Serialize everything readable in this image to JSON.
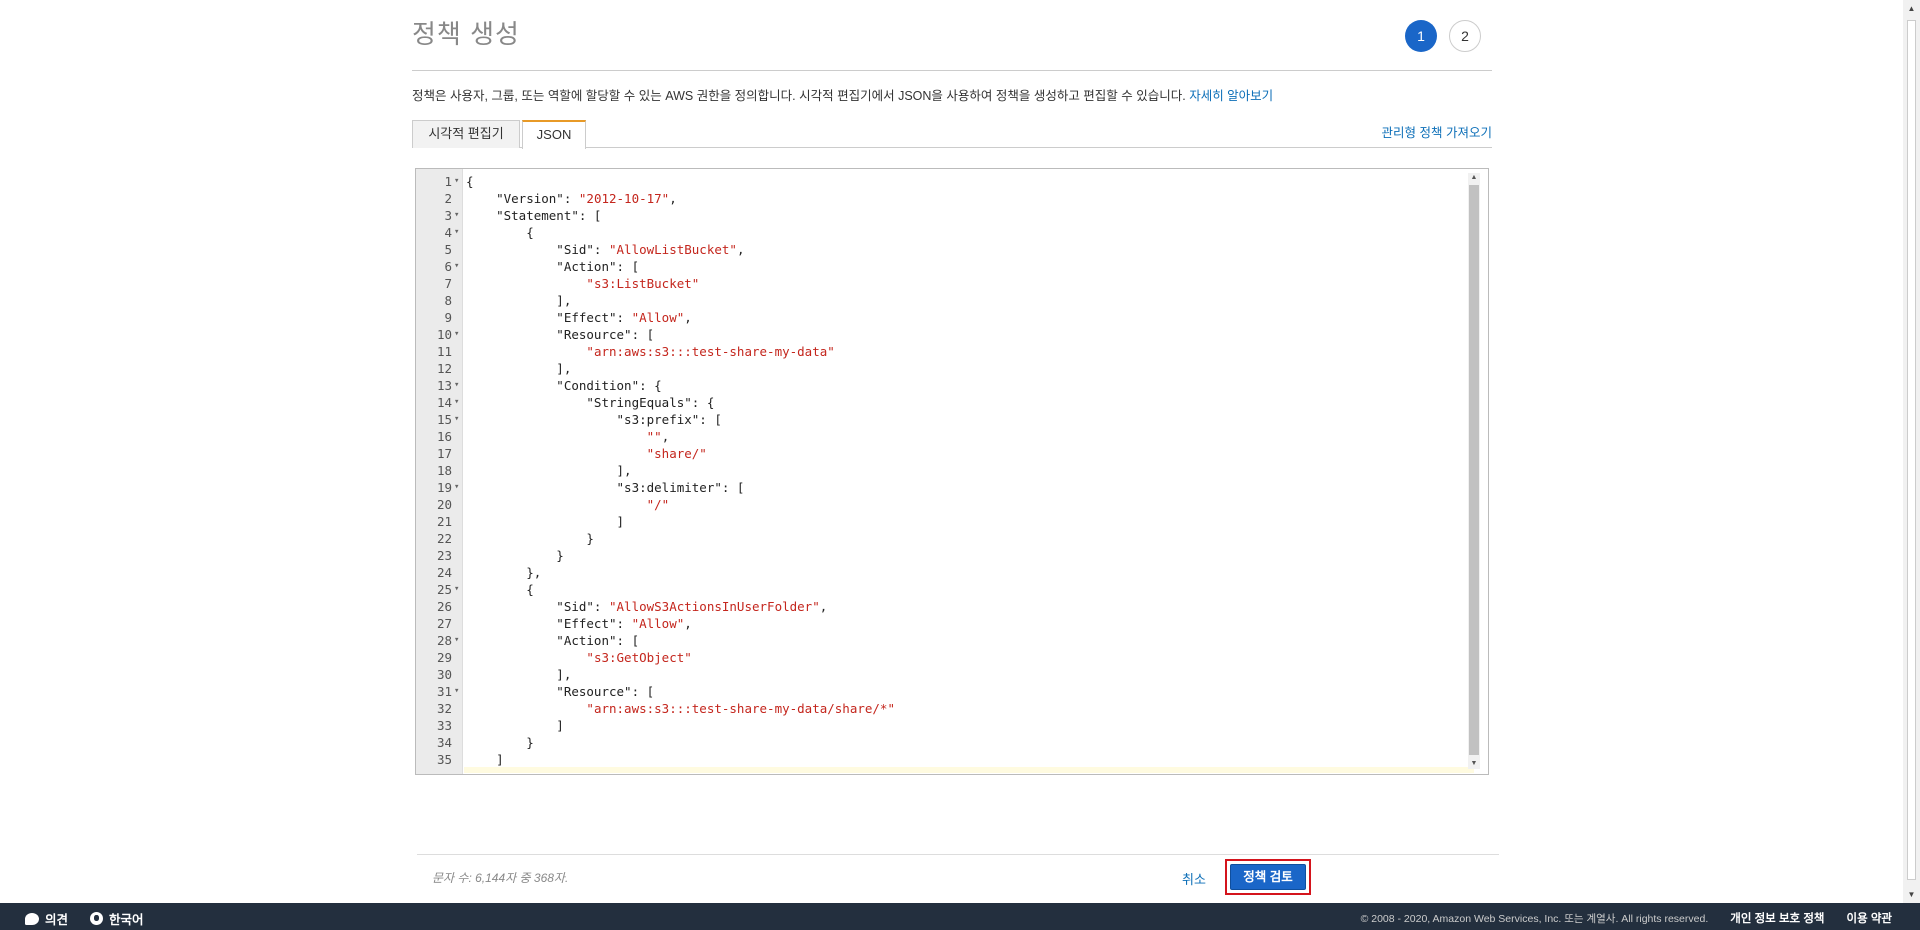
{
  "page": {
    "title": "정책 생성"
  },
  "steps": [
    "1",
    "2"
  ],
  "description": {
    "text": "정책은 사용자, 그룹, 또는 역할에 할당할 수 있는 AWS 권한을 정의합니다. 시각적 편집기에서 JSON을 사용하여 정책을 생성하고 편집할 수 있습니다. ",
    "learn_more": "자세히 알아보기"
  },
  "tabs": {
    "visual": "시각적 편집기",
    "json": "JSON"
  },
  "import_link": "관리형 정책 가져오기",
  "editor": {
    "lines": [
      {
        "n": "1",
        "fold": true,
        "code": [
          [
            "p",
            "{"
          ]
        ]
      },
      {
        "n": "2",
        "fold": false,
        "code": [
          [
            "p",
            "    \"Version\": "
          ],
          [
            "s",
            "\"2012-10-17\""
          ],
          [
            "p",
            ","
          ]
        ]
      },
      {
        "n": "3",
        "fold": true,
        "code": [
          [
            "p",
            "    \"Statement\": ["
          ]
        ]
      },
      {
        "n": "4",
        "fold": true,
        "code": [
          [
            "p",
            "        {"
          ]
        ]
      },
      {
        "n": "5",
        "fold": false,
        "code": [
          [
            "p",
            "            \"Sid\": "
          ],
          [
            "s",
            "\"AllowListBucket\""
          ],
          [
            "p",
            ","
          ]
        ]
      },
      {
        "n": "6",
        "fold": true,
        "code": [
          [
            "p",
            "            \"Action\": ["
          ]
        ]
      },
      {
        "n": "7",
        "fold": false,
        "code": [
          [
            "p",
            "                "
          ],
          [
            "s",
            "\"s3:ListBucket\""
          ]
        ]
      },
      {
        "n": "8",
        "fold": false,
        "code": [
          [
            "p",
            "            ],"
          ]
        ]
      },
      {
        "n": "9",
        "fold": false,
        "code": [
          [
            "p",
            "            \"Effect\": "
          ],
          [
            "s",
            "\"Allow\""
          ],
          [
            "p",
            ","
          ]
        ]
      },
      {
        "n": "10",
        "fold": true,
        "code": [
          [
            "p",
            "            \"Resource\": ["
          ]
        ]
      },
      {
        "n": "11",
        "fold": false,
        "code": [
          [
            "p",
            "                "
          ],
          [
            "s",
            "\"arn:aws:s3:::test-share-my-data\""
          ]
        ]
      },
      {
        "n": "12",
        "fold": false,
        "code": [
          [
            "p",
            "            ],"
          ]
        ]
      },
      {
        "n": "13",
        "fold": true,
        "code": [
          [
            "p",
            "            \"Condition\": {"
          ]
        ]
      },
      {
        "n": "14",
        "fold": true,
        "code": [
          [
            "p",
            "                \"StringEquals\": {"
          ]
        ]
      },
      {
        "n": "15",
        "fold": true,
        "code": [
          [
            "p",
            "                    \"s3:prefix\": ["
          ]
        ]
      },
      {
        "n": "16",
        "fold": false,
        "code": [
          [
            "p",
            "                        "
          ],
          [
            "s",
            "\"\""
          ],
          [
            "p",
            ","
          ]
        ]
      },
      {
        "n": "17",
        "fold": false,
        "code": [
          [
            "p",
            "                        "
          ],
          [
            "s",
            "\"share/\""
          ]
        ]
      },
      {
        "n": "18",
        "fold": false,
        "code": [
          [
            "p",
            "                    ],"
          ]
        ]
      },
      {
        "n": "19",
        "fold": true,
        "code": [
          [
            "p",
            "                    \"s3:delimiter\": ["
          ]
        ]
      },
      {
        "n": "20",
        "fold": false,
        "code": [
          [
            "p",
            "                        "
          ],
          [
            "s",
            "\"/\""
          ]
        ]
      },
      {
        "n": "21",
        "fold": false,
        "code": [
          [
            "p",
            "                    ]"
          ]
        ]
      },
      {
        "n": "22",
        "fold": false,
        "code": [
          [
            "p",
            "                }"
          ]
        ]
      },
      {
        "n": "23",
        "fold": false,
        "code": [
          [
            "p",
            "            }"
          ]
        ]
      },
      {
        "n": "24",
        "fold": false,
        "code": [
          [
            "p",
            "        },"
          ]
        ]
      },
      {
        "n": "25",
        "fold": true,
        "code": [
          [
            "p",
            "        {"
          ]
        ]
      },
      {
        "n": "26",
        "fold": false,
        "code": [
          [
            "p",
            "            \"Sid\": "
          ],
          [
            "s",
            "\"AllowS3ActionsInUserFolder\""
          ],
          [
            "p",
            ","
          ]
        ]
      },
      {
        "n": "27",
        "fold": false,
        "code": [
          [
            "p",
            "            \"Effect\": "
          ],
          [
            "s",
            "\"Allow\""
          ],
          [
            "p",
            ","
          ]
        ]
      },
      {
        "n": "28",
        "fold": true,
        "code": [
          [
            "p",
            "            \"Action\": ["
          ]
        ]
      },
      {
        "n": "29",
        "fold": false,
        "code": [
          [
            "p",
            "                "
          ],
          [
            "s",
            "\"s3:GetObject\""
          ]
        ]
      },
      {
        "n": "30",
        "fold": false,
        "code": [
          [
            "p",
            "            ],"
          ]
        ]
      },
      {
        "n": "31",
        "fold": true,
        "code": [
          [
            "p",
            "            \"Resource\": ["
          ]
        ]
      },
      {
        "n": "32",
        "fold": false,
        "code": [
          [
            "p",
            "                "
          ],
          [
            "s",
            "\"arn:aws:s3:::test-share-my-data/share/*\""
          ]
        ]
      },
      {
        "n": "33",
        "fold": false,
        "code": [
          [
            "p",
            "            ]"
          ]
        ]
      },
      {
        "n": "34",
        "fold": false,
        "code": [
          [
            "p",
            "        }"
          ]
        ]
      },
      {
        "n": "35",
        "fold": false,
        "code": [
          [
            "p",
            "    ]"
          ]
        ]
      }
    ]
  },
  "footer": {
    "char_count": "문자 수: 6,144자 중 368자.",
    "cancel": "취소",
    "review": "정책 검토"
  },
  "bottombar": {
    "feedback": "의견",
    "language": "한국어",
    "copyright": "© 2008 - 2020, Amazon Web Services, Inc. 또는 계열사. All rights reserved.",
    "privacy": "개인 정보 보호 정책",
    "terms": "이용 약관"
  },
  "colors": {
    "accent": "#1a66c8",
    "highlight": "#d4141c",
    "tab_active": "#e89a27",
    "footer_bg": "#232f3e",
    "string": "#c4261d"
  },
  "icons": {
    "feedback": "speech-bubble-icon",
    "language": "globe-icon"
  }
}
